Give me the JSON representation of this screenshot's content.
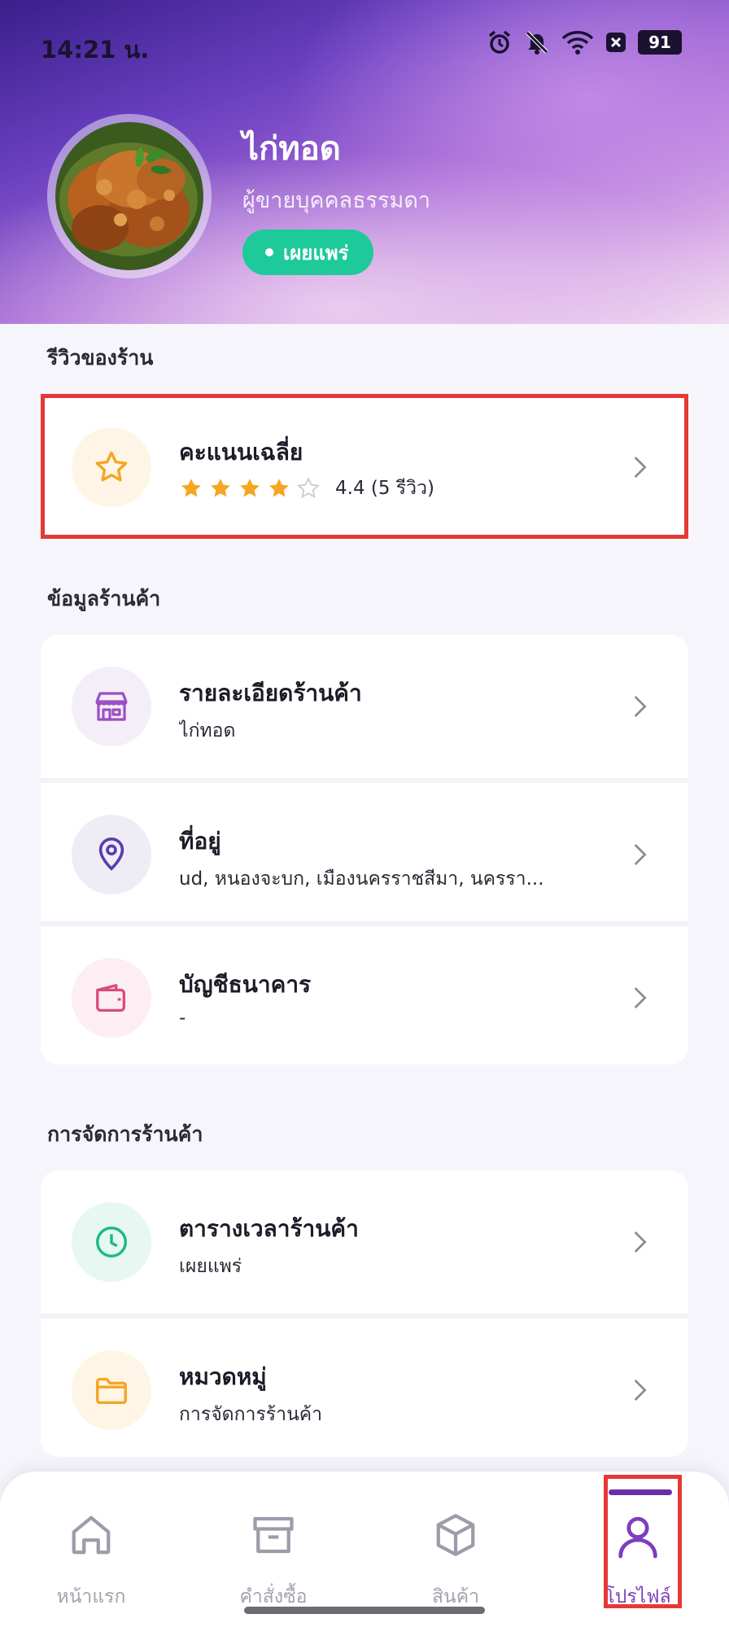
{
  "status_bar": {
    "time": "14:21 น.",
    "battery": "91",
    "icons": [
      "alarm-icon",
      "mute-icon",
      "wifi-icon",
      "notification-x-icon"
    ]
  },
  "profile": {
    "shop_name": "ไก่ทอด",
    "seller_type": "ผู้ขายบุคคลธรรมดา",
    "status": "เผยแพร่"
  },
  "reviews": {
    "section_title": "รีวิวของร้าน",
    "title": "คะแนนเฉลี่ย",
    "rating": 4.4,
    "stars_filled": 4,
    "stars_total": 5,
    "rating_text": "4.4 (5 รีวิว)"
  },
  "store_info": {
    "section_title": "ข้อมูลร้านค้า",
    "items": [
      {
        "title": "รายละเอียดร้านค้า",
        "subtitle": "ไก่ทอด",
        "icon": "store-icon"
      },
      {
        "title": "ที่อยู่",
        "subtitle": "ud, หนองจะบก, เมืองนครราชสีมา, นครรา...",
        "icon": "location-pin-icon"
      },
      {
        "title": "บัญชีธนาคาร",
        "subtitle": "-",
        "icon": "wallet-icon"
      }
    ]
  },
  "store_management": {
    "section_title": "การจัดการร้านค้า",
    "items": [
      {
        "title": "ตารางเวลาร้านค้า",
        "subtitle": "เผยแพร่",
        "icon": "clock-icon"
      },
      {
        "title": "หมวดหมู่",
        "subtitle": "การจัดการร้านค้า",
        "icon": "folder-icon"
      }
    ]
  },
  "bottom_nav": {
    "items": [
      {
        "label": "หน้าแรก",
        "icon": "home-icon"
      },
      {
        "label": "คำสั่งซื้อ",
        "icon": "archive-box-icon"
      },
      {
        "label": "สินค้า",
        "icon": "cube-icon"
      },
      {
        "label": "โปรไฟล์",
        "icon": "user-icon"
      }
    ],
    "active": "โปรไฟล์"
  },
  "colors": {
    "brand_purple": "#7c3fbf",
    "published_green": "#1ec99a",
    "star_orange": "#f5a623",
    "highlight_red": "#e53935"
  }
}
